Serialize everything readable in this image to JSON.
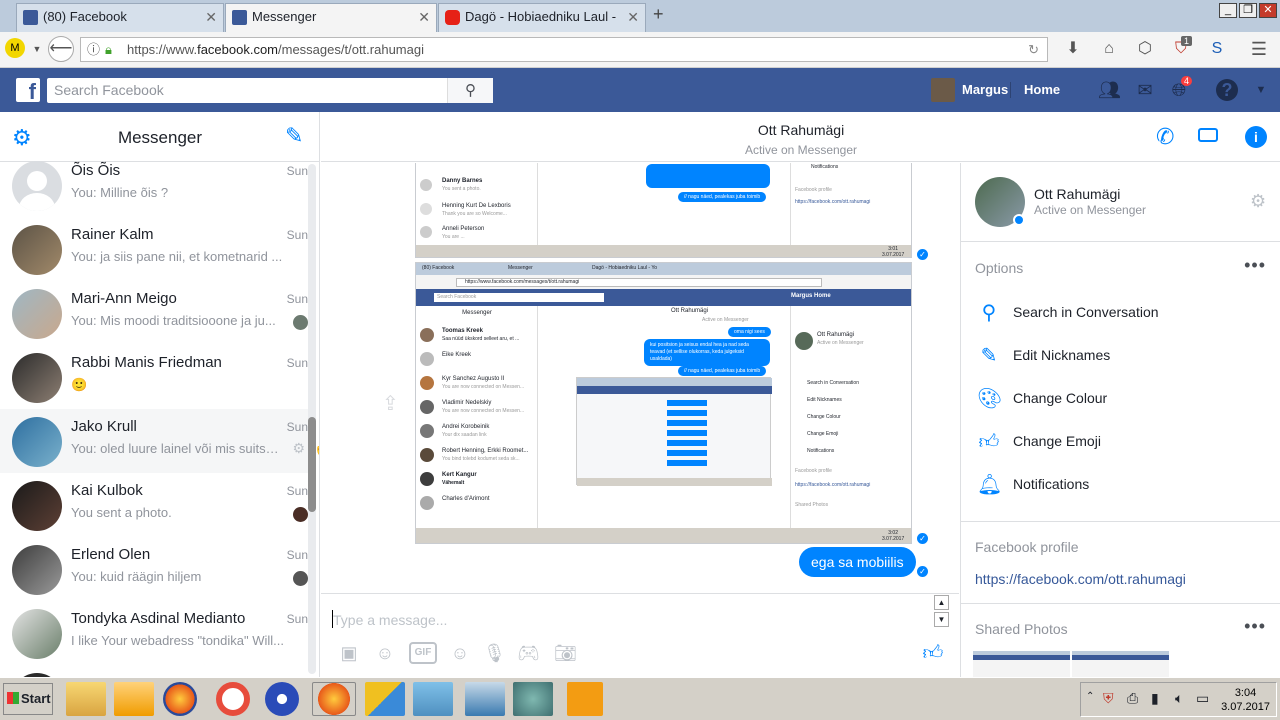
{
  "browser": {
    "tabs": [
      {
        "label": "(80) Facebook",
        "favicon": "facebook-icon",
        "active": false
      },
      {
        "label": "Messenger",
        "favicon": "facebook-icon",
        "active": true
      },
      {
        "label": "Dagö - Hobiaedniku Laul - Yo",
        "favicon": "youtube-icon",
        "active": false
      }
    ],
    "new_tab": "+",
    "url_prefix": "https://www.",
    "url_domain": "facebook.com",
    "url_path": "/messages/t/ott.rahumagi",
    "badge_count": "1"
  },
  "fb_header": {
    "search_placeholder": "Search Facebook",
    "user_name": "Margus",
    "home_label": "Home",
    "notification_count": "4",
    "brand_color": "#3b5998"
  },
  "left": {
    "title": "Messenger",
    "conversations": [
      {
        "name": "Õis Õis",
        "preview": "You: Milline õis ?",
        "date": "Sun"
      },
      {
        "name": "Rainer Kalm",
        "preview": "You: ja siis pane nii, et kometnarid ...",
        "date": "Sun"
      },
      {
        "name": "Mari-Ann Meigo",
        "preview": "You: Mis moodi traditsiooone ja ju...",
        "date": "Sun"
      },
      {
        "name": "Rabbi Manis Friedman",
        "preview": "🙂",
        "date": "Sun"
      },
      {
        "name": "Jako Krull",
        "preview": "You: oled luure lainel või mis suitset...",
        "date": "Sun"
      },
      {
        "name": "Kai Kulbok",
        "preview": "You sent a photo.",
        "date": "Sun"
      },
      {
        "name": "Erlend Olen",
        "preview": "You: kuid räägin hiljem",
        "date": "Sun"
      },
      {
        "name": "Tondyka Asdinal Medianto",
        "preview": "I like Your webadress \"tondika\" Will...",
        "date": "Sun"
      }
    ]
  },
  "chat": {
    "contact_name": "Ott Rahumägi",
    "contact_status": "Active on Messenger",
    "last_message": "ega sa mobiilis",
    "composer_placeholder": "Type a message...",
    "accent_color": "#0084ff",
    "mini_shot": {
      "tab1": "(80) Facebook",
      "tab2": "Messenger",
      "tab3": "Dagö - Hobiaedniku Laul - Yo",
      "url": "https://www.facebook.com/messages/t/ott.rahumagi",
      "search": "Search Facebook",
      "user": "Margus",
      "home": "Home",
      "left_title": "Messenger",
      "contact": "Ott Rahumägi",
      "status": "Active on Messenger",
      "contacts": [
        "Toomas Kreek",
        "Eike Kreek",
        "Kyr Sanchez Augusto II",
        "Vladimir Nedelskiy",
        "Andrei Korobeinik",
        "Robert Henning, Erkki Roomet...",
        "Kert Kangur",
        "Charles d'Arimont"
      ],
      "previews": [
        "Saa nüüd ükskord selleet aru, et ...",
        "You are now connected on Messen...",
        "You are now connected on Messen...",
        "Your dix saadan link",
        "You bind tolebd kodumet seda sk...",
        "Vähemalt"
      ],
      "bubbles": [
        "oma nigi sees",
        "kui positsion ja seisus endal hea ja nad seda teavad (et sellise olukorras, keda julgeksid usaldada)",
        "// nagu näed, pealekas juba toimib"
      ],
      "options": [
        "Search in Conversation",
        "Edit Nicknames",
        "Change Colour",
        "Change Emoji",
        "Notifications"
      ],
      "profile_label": "Facebook profile",
      "profile_url": "https://facebook.com/ott.rahumagi",
      "shared": "Shared Photos",
      "clock_time": "3:02",
      "clock_date": "3.07.2017"
    },
    "top_shot": {
      "contacts": [
        "Danny Barnes",
        "Henning Kurt De Lexboris",
        "Anneli Peterson"
      ],
      "previews": [
        "You sent a photo.",
        "Thank you are so Welcome...",
        "You are ..."
      ],
      "bubble": "// nagu näed, pealekas juba toimib",
      "options": [
        "Notifications"
      ],
      "profile_label": "Facebook profile",
      "profile_url": "https://facebook.com/ott.rahumagi",
      "clock_time": "3:01",
      "clock_date": "3.07.2017"
    }
  },
  "right": {
    "name": "Ott Rahumägi",
    "status": "Active on Messenger",
    "options_title": "Options",
    "options": [
      {
        "label": "Search in Conversation",
        "icon": "search-icon"
      },
      {
        "label": "Edit Nicknames",
        "icon": "pencil-icon"
      },
      {
        "label": "Change Colour",
        "icon": "palette-icon"
      },
      {
        "label": "Change Emoji",
        "icon": "thumbs-up-icon"
      },
      {
        "label": "Notifications",
        "icon": "bell-icon"
      }
    ],
    "profile_title": "Facebook profile",
    "profile_url": "https://facebook.com/ott.rahumagi",
    "shared_title": "Shared Photos"
  },
  "taskbar": {
    "start_label": "Start",
    "time": "3:04",
    "date": "3.07.2017"
  }
}
